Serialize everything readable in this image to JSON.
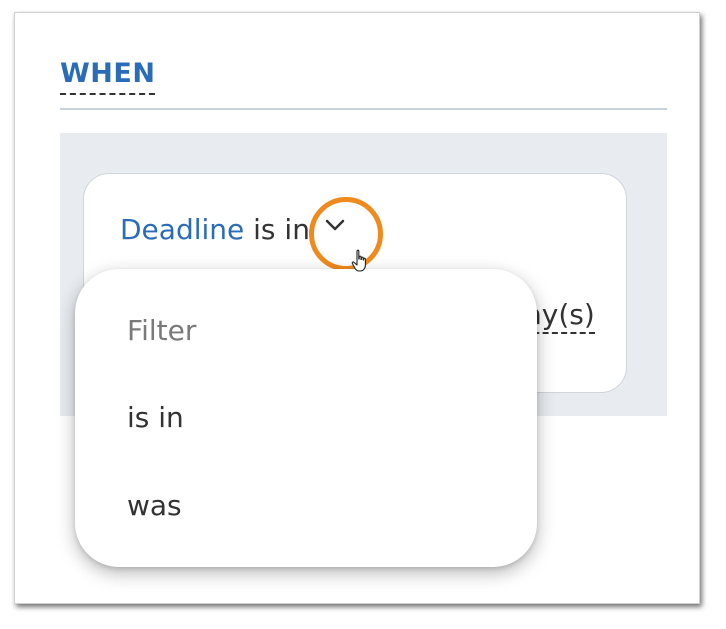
{
  "section": {
    "title": "WHEN"
  },
  "condition": {
    "field": "Deadline",
    "operator": "is in",
    "value_visible": "ny(s)"
  },
  "dropdown": {
    "filter_placeholder": "Filter",
    "options": [
      "is in",
      "was"
    ]
  },
  "colors": {
    "accent_blue": "#2b6cb8",
    "highlight_orange": "#f08a1c",
    "panel_gray": "#e8ecf0"
  },
  "icons": {
    "operator_toggle": "chevron-down-icon",
    "pointer": "hand-pointer-icon"
  }
}
